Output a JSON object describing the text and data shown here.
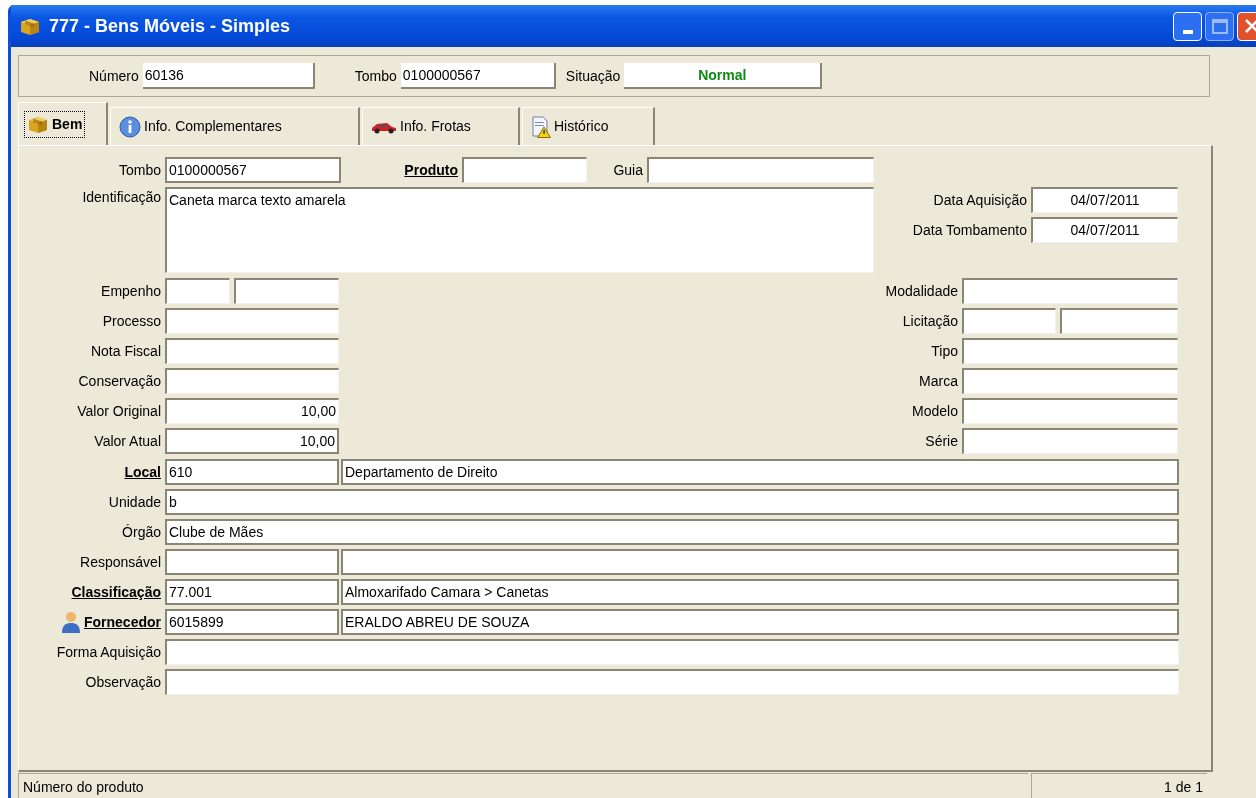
{
  "window": {
    "title": "777 - Bens Móveis - Simples"
  },
  "header": [
    {
      "label": "Número",
      "value": "60136",
      "kind": "text"
    },
    {
      "label": "Tombo",
      "value": "0100000567",
      "kind": "text"
    },
    {
      "label": "Situação",
      "value": "Normal",
      "kind": "status"
    }
  ],
  "tabs": [
    {
      "label": "Bem",
      "selected": true
    },
    {
      "label": "Info. Complementares",
      "selected": false
    },
    {
      "label": "Info. Frotas",
      "selected": false
    },
    {
      "label": "Histórico",
      "selected": false
    }
  ],
  "form": {
    "top": [
      {
        "label": "Tombo",
        "value": "0100000567",
        "link": false
      },
      {
        "label": "Produto",
        "link": true
      },
      {
        "label": "Guia",
        "link": false
      }
    ],
    "identificacao": {
      "label": "Identificação",
      "value": "Caneta marca texto amarela"
    },
    "dates": [
      {
        "label": "Data Aquisição",
        "value": "04/07/2011"
      },
      {
        "label": "Data Tombamento",
        "value": "04/07/2011"
      }
    ],
    "left_fields": [
      {
        "label": "Empenho",
        "kind": "pair"
      },
      {
        "label": "Processo",
        "kind": "single"
      },
      {
        "label": "Nota Fiscal",
        "kind": "single"
      },
      {
        "label": "Conservação",
        "kind": "single"
      },
      {
        "label": "Valor Original",
        "kind": "number",
        "value": "10,00"
      },
      {
        "label": "Valor Atual",
        "kind": "number",
        "value": "10,00"
      }
    ],
    "right_fields": [
      {
        "label": "Modalidade",
        "kind": "single"
      },
      {
        "label": "Licitação",
        "kind": "pair"
      },
      {
        "label": "Tipo",
        "kind": "single"
      },
      {
        "label": "Marca",
        "kind": "single"
      },
      {
        "label": "Modelo",
        "kind": "single"
      },
      {
        "label": "Série",
        "kind": "single"
      }
    ],
    "wide_fields": [
      {
        "label": "Local",
        "kind": "lookup",
        "link": true,
        "value": "610",
        "description": "Departamento de Direito"
      },
      {
        "label": "Unidade",
        "kind": "single",
        "link": false,
        "value": "b"
      },
      {
        "label": "Órgão",
        "kind": "single",
        "link": false,
        "value": "Clube de Mães"
      },
      {
        "label": "Responsável",
        "kind": "lookup",
        "link": false
      },
      {
        "label": "Classificação",
        "kind": "lookup",
        "link": true,
        "value": "77.001",
        "description": "Almoxarifado Camara > Canetas"
      },
      {
        "label": "Fornecedor",
        "kind": "contact_lookup",
        "link": true,
        "value": "6015899",
        "description": "ERALDO ABREU DE SOUZA"
      },
      {
        "label": "Forma Aquisição",
        "kind": "single",
        "link": false
      },
      {
        "label": "Observação",
        "kind": "single",
        "link": false
      }
    ]
  },
  "status_bar": {
    "message": "Número do produto",
    "record": "1 de 1"
  }
}
